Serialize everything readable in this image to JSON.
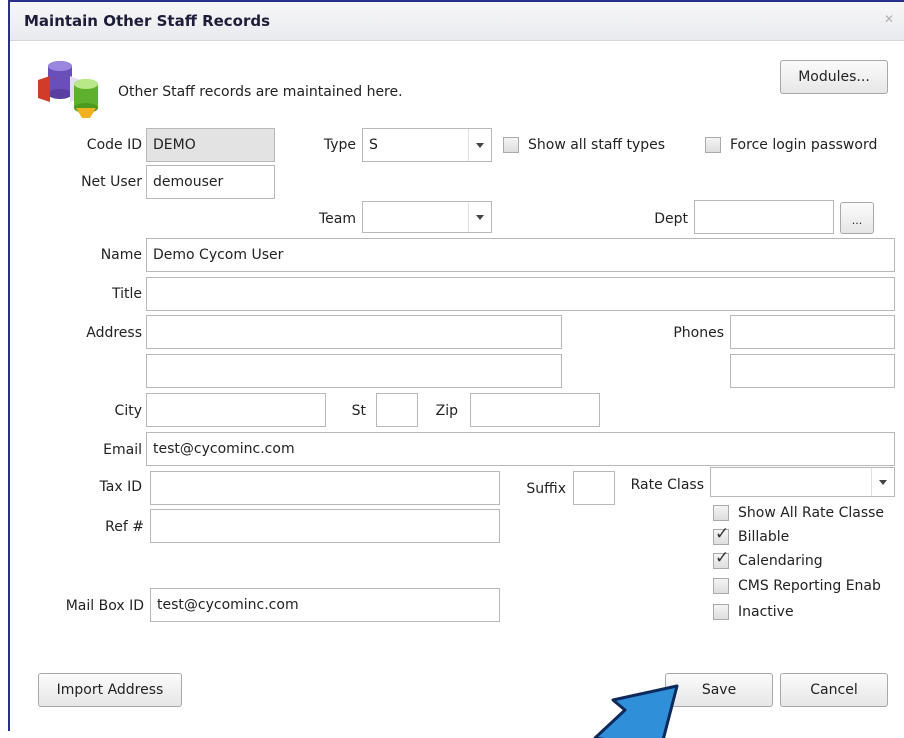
{
  "window": {
    "title": "Maintain Other Staff Records",
    "close_glyph": "✕"
  },
  "header": {
    "description": "Other Staff records are maintained here.",
    "modules_button": "Modules..."
  },
  "fields": {
    "code_id": {
      "label": "Code ID",
      "value": "DEMO"
    },
    "type": {
      "label": "Type",
      "value": "S"
    },
    "show_all_staff_types": {
      "label": "Show all staff types",
      "checked": false
    },
    "force_login_password": {
      "label": "Force login password",
      "checked": false
    },
    "net_user": {
      "label": "Net User",
      "value": "demouser"
    },
    "team": {
      "label": "Team",
      "value": ""
    },
    "dept": {
      "label": "Dept",
      "value": "",
      "browse": "..."
    },
    "name": {
      "label": "Name",
      "value": "Demo Cycom User"
    },
    "title": {
      "label": "Title",
      "value": ""
    },
    "address": {
      "label": "Address",
      "line1": "",
      "line2": ""
    },
    "phones": {
      "label": "Phones",
      "phone1": "",
      "phone2": ""
    },
    "city": {
      "label": "City",
      "value": ""
    },
    "st": {
      "label": "St",
      "value": ""
    },
    "zip": {
      "label": "Zip",
      "value": ""
    },
    "email": {
      "label": "Email",
      "value": "test@cycominc.com"
    },
    "tax_id": {
      "label": "Tax ID",
      "value": ""
    },
    "suffix": {
      "label": "Suffix",
      "value": ""
    },
    "rate_class": {
      "label": "Rate Class",
      "value": ""
    },
    "ref": {
      "label": "Ref #",
      "value": ""
    },
    "mail_box_id": {
      "label": "Mail Box ID",
      "value": "test@cycominc.com"
    }
  },
  "options": [
    {
      "label": "Show All Rate Classe",
      "checked": false
    },
    {
      "label": "Billable",
      "checked": true
    },
    {
      "label": "Calendaring",
      "checked": true
    },
    {
      "label": "CMS Reporting Enab",
      "checked": false
    },
    {
      "label": "Inactive",
      "checked": false
    }
  ],
  "footer": {
    "import_address": "Import Address",
    "save": "Save",
    "cancel": "Cancel"
  },
  "colors": {
    "frame": "#2a2f8a",
    "pointer": "#2f8fd8",
    "pointer_outline": "#0d2a5c"
  },
  "icons": {
    "logo": "staff-records-logo-icon",
    "pointer": "pointing-arrow-icon"
  }
}
